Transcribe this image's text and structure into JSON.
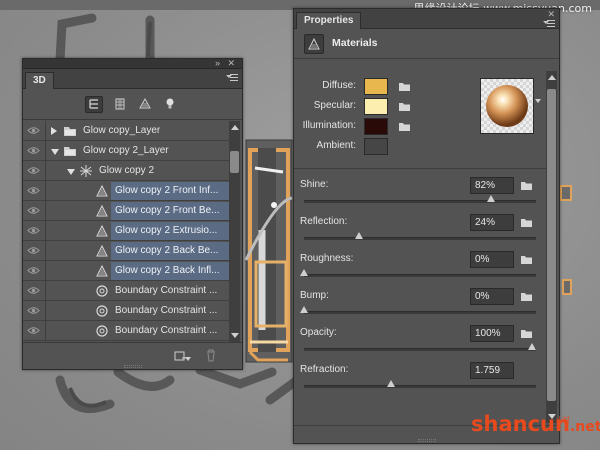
{
  "watermark": {
    "top_text": "思缘设计论坛 www.missyuan.com",
    "bottom_text": "shancun",
    "bottom_suffix": ".net",
    "bottom_cn": "山村"
  },
  "panel3d": {
    "tab_label": "3D",
    "filter_icons": [
      "whole-scene-icon",
      "meshes-icon",
      "materials-icon",
      "lights-icon"
    ],
    "layers": [
      {
        "name": "Glow copy_Layer",
        "expand": "collapsed",
        "icon": "folder-icon",
        "indent": 0,
        "selected": false
      },
      {
        "name": "Glow copy 2_Layer",
        "expand": "expanded",
        "icon": "folder-icon",
        "indent": 0,
        "selected": false
      },
      {
        "name": "Glow copy 2",
        "expand": "expanded",
        "icon": "mesh-icon",
        "indent": 1,
        "selected": false
      },
      {
        "name": "Glow copy 2 Front Inf...",
        "expand": "none",
        "icon": "material-icon",
        "indent": 2,
        "selected": true
      },
      {
        "name": "Glow copy 2 Front Be...",
        "expand": "none",
        "icon": "material-icon",
        "indent": 2,
        "selected": true
      },
      {
        "name": "Glow copy 2 Extrusio...",
        "expand": "none",
        "icon": "material-icon",
        "indent": 2,
        "selected": true
      },
      {
        "name": "Glow copy 2 Back Be...",
        "expand": "none",
        "icon": "material-icon",
        "indent": 2,
        "selected": true
      },
      {
        "name": "Glow copy 2 Back Infl...",
        "expand": "none",
        "icon": "material-icon",
        "indent": 2,
        "selected": true
      },
      {
        "name": "Boundary Constraint ...",
        "expand": "none",
        "icon": "constraint-icon",
        "indent": 2,
        "selected": false
      },
      {
        "name": "Boundary Constraint ...",
        "expand": "none",
        "icon": "constraint-icon",
        "indent": 2,
        "selected": false
      },
      {
        "name": "Boundary Constraint ...",
        "expand": "none",
        "icon": "constraint-icon",
        "indent": 2,
        "selected": false
      }
    ]
  },
  "properties": {
    "tab_label": "Properties",
    "title": "Materials",
    "materials": [
      {
        "label": "Diffuse:",
        "color": "#e8b84f"
      },
      {
        "label": "Specular:",
        "color": "#fbeeae"
      },
      {
        "label": "Illumination:",
        "color": "#2a0a08"
      },
      {
        "label": "Ambient:",
        "color": "#464646"
      }
    ],
    "sliders": [
      {
        "label": "Shine:",
        "value": "82%",
        "level": 0.82
      },
      {
        "label": "Reflection:",
        "value": "24%",
        "level": 0.24
      },
      {
        "label": "Roughness:",
        "value": "0%",
        "level": 0.0
      },
      {
        "label": "Bump:",
        "value": "0%",
        "level": 0.0
      },
      {
        "label": "Opacity:",
        "value": "100%",
        "level": 1.0
      },
      {
        "label": "Refraction:",
        "value": "1.759",
        "level": 0.38
      }
    ]
  }
}
